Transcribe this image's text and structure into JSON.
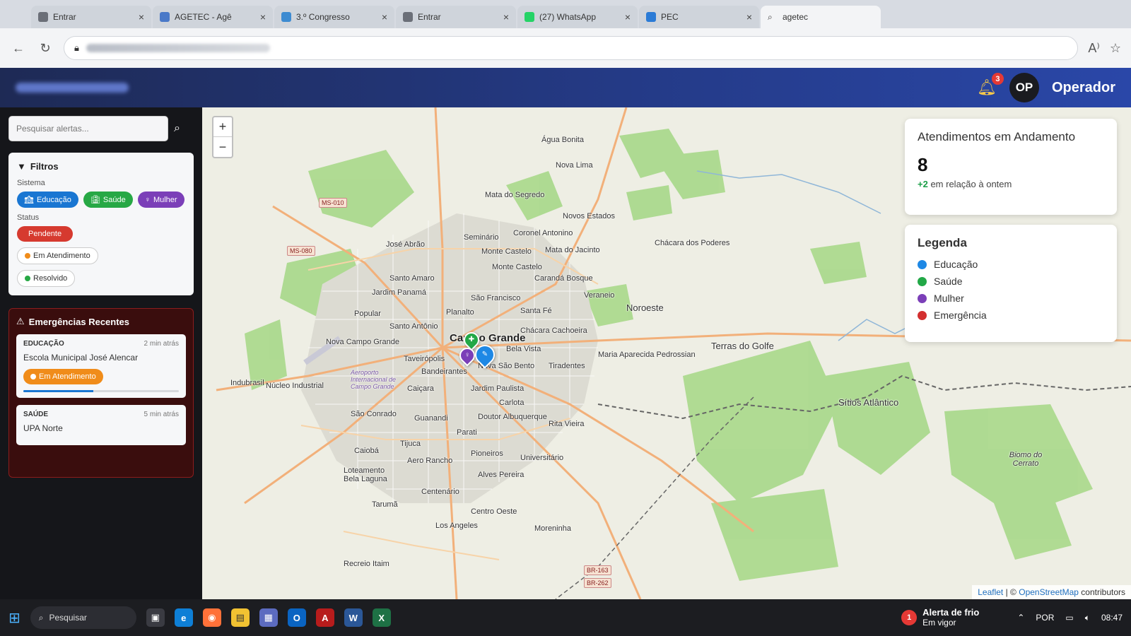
{
  "browser": {
    "tabs": [
      {
        "title": "Entrar",
        "color": "#6b6f78",
        "active": false
      },
      {
        "title": "AGETEC - Agê",
        "color": "#4a79c8",
        "active": false
      },
      {
        "title": "3.º Congresso",
        "color": "#3d8bd1",
        "active": false
      },
      {
        "title": "Entrar",
        "color": "#6b6f78",
        "active": false
      },
      {
        "title": "(27) WhatsApp",
        "color": "#25d366",
        "active": false
      },
      {
        "title": "PEC",
        "color": "#2b7bd6",
        "active": false
      },
      {
        "title": "agetec",
        "color": "#888888",
        "active": true
      }
    ]
  },
  "header": {
    "notification_count": "3",
    "avatar_initials": "OP",
    "user_name": "Operador"
  },
  "sidebar": {
    "search_placeholder": "Pesquisar alertas...",
    "filters": {
      "title": "Filtros",
      "sistema_label": "Sistema",
      "sistema_chips": [
        "Educação",
        "Saúde",
        "Mulher"
      ],
      "status_label": "Status",
      "status_chips": [
        "Pendente",
        "Em Atendimento",
        "Resolvido"
      ]
    },
    "emergencies": {
      "title": "Emergências Recentes",
      "items": [
        {
          "category": "EDUCAÇÃO",
          "time": "2 min atrás",
          "name": "Escola Municipal José Alencar",
          "status": "Em Atendimento",
          "progress": 0.45
        },
        {
          "category": "SAÚDE",
          "time": "5 min atrás",
          "name": "UPA Norte"
        }
      ]
    }
  },
  "map": {
    "zoom_in": "+",
    "zoom_out": "−",
    "places": {
      "campo_grande": "Campo Grande",
      "agua_bonita": "Água Bonita",
      "nova_lima": "Nova Lima",
      "mata_segredo": "Mata do Segredo",
      "novos_estados": "Novos Estados",
      "seminario": "Seminário",
      "coronel_antonino": "Coronel Antonino",
      "jose_abrao": "José Abrão",
      "monte_castelo": "Monte Castelo",
      "mata_jacinto": "Mata do Jacinto",
      "chacara_poderes": "Chácara dos Poderes",
      "santo_amaro": "Santo Amaro",
      "jardim_panama": "Jardim Panamá",
      "caranda_bosque": "Carandá Bosque",
      "veraneio": "Veraneio",
      "sao_francisco": "São Francisco",
      "popular": "Popular",
      "planalto": "Planalto",
      "santa_fe": "Santa Fé",
      "noroeste": "Noroeste",
      "santo_antonio": "Santo Antônio",
      "chacara_cachoeira": "Chácara Cachoeira",
      "nova_campo_grande": "Nova Campo Grande",
      "taveiropolis": "Taveirópolis",
      "bela_vista": "Bela Vista",
      "maria_aparecida": "Maria Aparecida Pedrossian",
      "terras_golfe": "Terras do Golfe",
      "aeroporto": "Aeroporto Internacional de Campo Grande",
      "bandeirantes": "Bandeirantes",
      "nova_sao_bento": "Nova São Bento",
      "tiradentes": "Tiradentes",
      "nucleo_industrial": "Núcleo Industrial",
      "indubrasil": "Indubrasil",
      "caicara": "Caiçara",
      "jardim_paulista": "Jardim Paulista",
      "carlota": "Carlota",
      "sitios_atlantico": "Sítios Atlântico",
      "sao_conrado": "São Conrado",
      "guanandi": "Guanandi",
      "doutor_albuquerque": "Doutor Albuquerque",
      "rita_vieira": "Rita Vieira",
      "parati": "Parati",
      "tijuca": "Tijuca",
      "caioba": "Caiobá",
      "pioneiros": "Pioneiros",
      "universitario": "Universitário",
      "aero_rancho": "Aero Rancho",
      "loteamento_bela_laguna": "Loteamento Bela Laguna",
      "alves_pereira": "Alves Pereira",
      "centenario": "Centenário",
      "taruma": "Tarumã",
      "centro_oeste": "Centro Oeste",
      "los_angeles": "Los Angeles",
      "moreninha": "Moreninha",
      "recreio_itaim": "Recreio Itaim",
      "biomo_cerrato": "Biomo do Cerrato"
    },
    "roads": [
      "MS-010",
      "MS-080",
      "BR-163",
      "BR-262"
    ],
    "stats": {
      "title": "Atendimentos em Andamento",
      "count": "8",
      "delta": "+2",
      "delta_text": "em relação à ontem"
    },
    "legend": {
      "title": "Legenda",
      "items": [
        {
          "label": "Educação",
          "color": "#1e88e5"
        },
        {
          "label": "Saúde",
          "color": "#22a847"
        },
        {
          "label": "Mulher",
          "color": "#7b3fb8"
        },
        {
          "label": "Emergência",
          "color": "#d32f2f"
        }
      ]
    },
    "attribution": {
      "leaflet": "Leaflet",
      "sep": "| ©",
      "osm": "OpenStreetMap",
      "contributors": "contributors"
    }
  },
  "taskbar": {
    "search_label": "Pesquisar",
    "weather_badge": "1",
    "weather_title": "Alerta de frio",
    "weather_sub": "Em vigor",
    "language": "POR",
    "time": "08:47"
  }
}
